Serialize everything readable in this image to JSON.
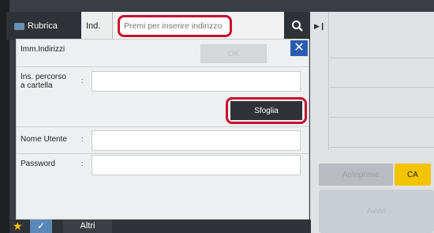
{
  "header": {
    "tab_rubrica": "Rubrica",
    "tab_ind": "Ind.",
    "address_placeholder": "Premi per inserire indirizzo"
  },
  "dialog": {
    "title": "Imm.Indirizzi",
    "ok_label": "OK",
    "folder_path_label_1": "Ins. percorso",
    "folder_path_label_2": "a cartella",
    "browse_label": "Sfoglia",
    "username_label": "Nome Utente",
    "password_label": "Password",
    "colon": ":"
  },
  "right_panel": {
    "preview_label": "Anteprima",
    "ca_label": "CA",
    "start_label": "Avvio"
  },
  "footer": {
    "other_label": "Altri"
  },
  "colors": {
    "highlight": "#c8102e",
    "close_blue": "#2a5db0",
    "ca_yellow": "#f4c400"
  }
}
